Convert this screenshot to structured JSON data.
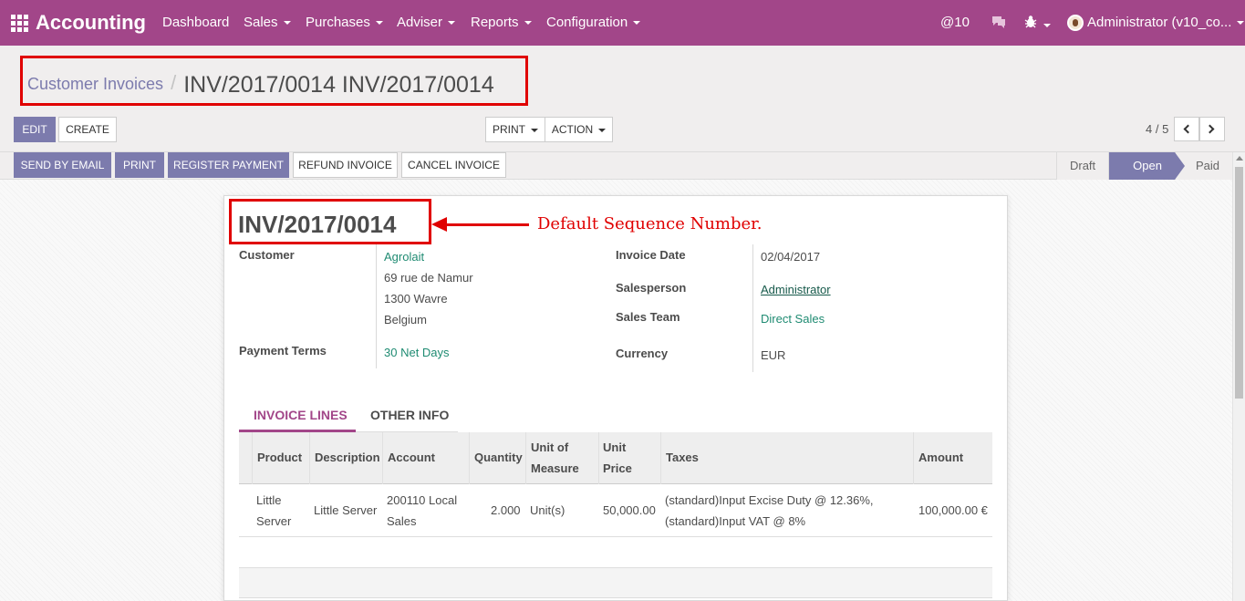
{
  "navbar": {
    "app_title": "Accounting",
    "menus": [
      {
        "label": "Dashboard",
        "has_caret": false
      },
      {
        "label": "Sales",
        "has_caret": true
      },
      {
        "label": "Purchases",
        "has_caret": true
      },
      {
        "label": "Adviser",
        "has_caret": true
      },
      {
        "label": "Reports",
        "has_caret": true
      },
      {
        "label": "Configuration",
        "has_caret": true
      }
    ],
    "mentions": "@10",
    "user": "Administrator (v10_co..."
  },
  "breadcrumb": {
    "parent": "Customer Invoices",
    "separator": "/",
    "current": "INV/2017/0014 INV/2017/0014"
  },
  "control_buttons": {
    "edit": "Edit",
    "create": "Create",
    "print": "Print",
    "action": "Action"
  },
  "pager": {
    "text": "4 / 5"
  },
  "form_buttons": {
    "send_by_email": "Send by Email",
    "print": "Print",
    "register_payment": "Register Payment",
    "refund_invoice": "Refund Invoice",
    "cancel_invoice": "Cancel Invoice"
  },
  "status": {
    "stages": [
      "Draft",
      "Open",
      "Paid"
    ],
    "active": "Open"
  },
  "invoice": {
    "number": "INV/2017/0014",
    "annotation": "Default Sequence Number.",
    "customer_label": "Customer",
    "customer_name": "Agrolait",
    "address_line1": "69 rue de Namur",
    "address_line2": "1300 Wavre",
    "address_line3": "Belgium",
    "payment_terms_label": "Payment Terms",
    "payment_terms": "30 Net Days",
    "invoice_date_label": "Invoice Date",
    "invoice_date": "02/04/2017",
    "salesperson_label": "Salesperson",
    "salesperson": "Administrator",
    "sales_team_label": "Sales Team",
    "sales_team": "Direct Sales",
    "currency_label": "Currency",
    "currency": "EUR"
  },
  "tabs": {
    "invoice_lines": "INVOICE LINES",
    "other_info": "OTHER INFO"
  },
  "table": {
    "headers": {
      "product": "Product",
      "description": "Description",
      "account": "Account",
      "quantity": "Quantity",
      "uom_1": "Unit of",
      "uom_2": "Measure",
      "unit_price_1": "Unit",
      "unit_price_2": "Price",
      "taxes": "Taxes",
      "amount": "Amount"
    },
    "rows": [
      {
        "product_1": "Little",
        "product_2": "Server",
        "description": "Little Server",
        "account_1": "200110 Local",
        "account_2": "Sales",
        "quantity": "2.000",
        "uom": "Unit(s)",
        "unit_price": "50,000.00",
        "taxes_1": "(standard)Input Excise Duty @ 12.36%,",
        "taxes_2": "(standard)Input VAT @ 8%",
        "amount": "100,000.00 €"
      }
    ]
  },
  "colors": {
    "brand": "#a24689",
    "primary_button": "#7c7bad",
    "link": "#1f8b72",
    "annotation": "#e00000"
  }
}
